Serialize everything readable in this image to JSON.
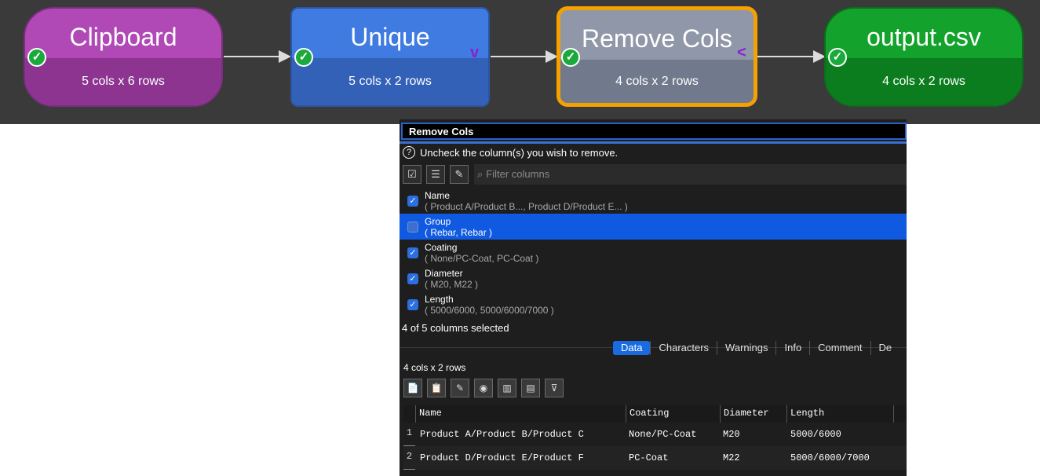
{
  "nodes": [
    {
      "title": "Clipboard",
      "sub": "5 cols x 6 rows"
    },
    {
      "title": "Unique",
      "sub": "5 cols x 2 rows"
    },
    {
      "title": "Remove Cols",
      "sub": "4 cols x 2 rows"
    },
    {
      "title": "output.csv",
      "sub": "4 cols x 2 rows"
    }
  ],
  "ports": {
    "unique_out": "v",
    "remove_out": "<"
  },
  "panel": {
    "title": "Remove Cols",
    "help": "Uncheck the column(s) you wish to remove.",
    "filter_placeholder": "Filter columns",
    "columns": [
      {
        "name": "Name",
        "values": "( Product A/Product B..., Product D/Product E... )",
        "checked": true
      },
      {
        "name": "Group",
        "values": "( Rebar, Rebar )",
        "checked": false
      },
      {
        "name": "Coating",
        "values": "( None/PC-Coat, PC-Coat )",
        "checked": true
      },
      {
        "name": "Diameter",
        "values": "( M20, M22 )",
        "checked": true
      },
      {
        "name": "Length",
        "values": "( 5000/6000, 5000/6000/7000 )",
        "checked": true
      }
    ],
    "selected_count": "4 of 5 columns selected",
    "tabs": [
      "Data",
      "Characters",
      "Warnings",
      "Info",
      "Comment",
      "De"
    ],
    "dims": "4 cols x 2 rows",
    "grid": {
      "headers": [
        "Name",
        "Coating",
        "Diameter",
        "Length"
      ],
      "rows": [
        {
          "num": "1",
          "cells": [
            "Product A/Product B/Product C",
            "None/PC-Coat",
            "M20",
            "5000/6000"
          ]
        },
        {
          "num": "2",
          "cells": [
            "Product D/Product E/Product F",
            "PC-Coat",
            "M22",
            "5000/6000/7000"
          ]
        }
      ]
    }
  },
  "colors": {
    "accent": "#1a6be0",
    "selected_node": "#f5a100"
  }
}
